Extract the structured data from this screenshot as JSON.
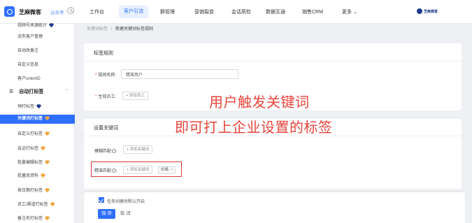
{
  "header": {
    "app_title": "芝麻微客",
    "gzh_label": "公众号",
    "nav": [
      "工作台",
      "客户引流",
      "群管理",
      "营销裂变",
      "会话质检",
      "数据互通",
      "销售CRM",
      "更多 ⌄"
    ],
    "active_nav_index": 1,
    "user": "芝麻微客"
  },
  "sidebar": {
    "items": [
      {
        "label": "视频号来源统计",
        "badge": "dark"
      },
      {
        "label": "流失客户管理"
      },
      {
        "label": "自动改备注"
      },
      {
        "label": "自定义信息"
      },
      {
        "label": "客户unionID"
      }
    ],
    "group_label": "自动打标签",
    "group_items": [
      {
        "label": "预打标签",
        "badge": "dark"
      },
      {
        "label": "关键词打标签",
        "badge": "gold",
        "active": true
      },
      {
        "label": "自定义打标签",
        "badge": "gold"
      },
      {
        "label": "会话打标签",
        "badge": "gold"
      },
      {
        "label": "批量编辑标签",
        "badge": "gold"
      },
      {
        "label": "批量改资料",
        "badge": "gold"
      },
      {
        "label": "按日期打标签",
        "badge": "gold"
      },
      {
        "label": "员工/渠道打标签",
        "badge": "gold"
      },
      {
        "label": "备注名打标签",
        "badge": "gold"
      }
    ]
  },
  "breadcrumb": {
    "parent": "关键词标签",
    "separator": "/",
    "current": "新建关键词标签规则"
  },
  "rules_section": {
    "title": "标签规则",
    "rule_name_label": "规则名称:",
    "rule_name_value": "精准用户",
    "staff_label": "生效员工:",
    "staff_button": "+ 添加员工"
  },
  "keyword_section": {
    "title": "设置关键词",
    "fuzzy_label": "模糊匹配",
    "fuzzy_button": "+ 添加关键词",
    "exact_label": "精准匹配",
    "exact_button": "+ 添加关键词",
    "exact_tags": [
      "价格"
    ]
  },
  "overlay": {
    "line1": "用户触发关键词",
    "line2": "即可打上企业设置的标签"
  },
  "footer": {
    "checkbox_label": "任务创建后默认开启",
    "save": "保 存",
    "cancel": "取 消"
  },
  "colors": {
    "accent": "#2f6fff",
    "annotation": "#e8453c",
    "highlight_border": "#d93a3a"
  }
}
